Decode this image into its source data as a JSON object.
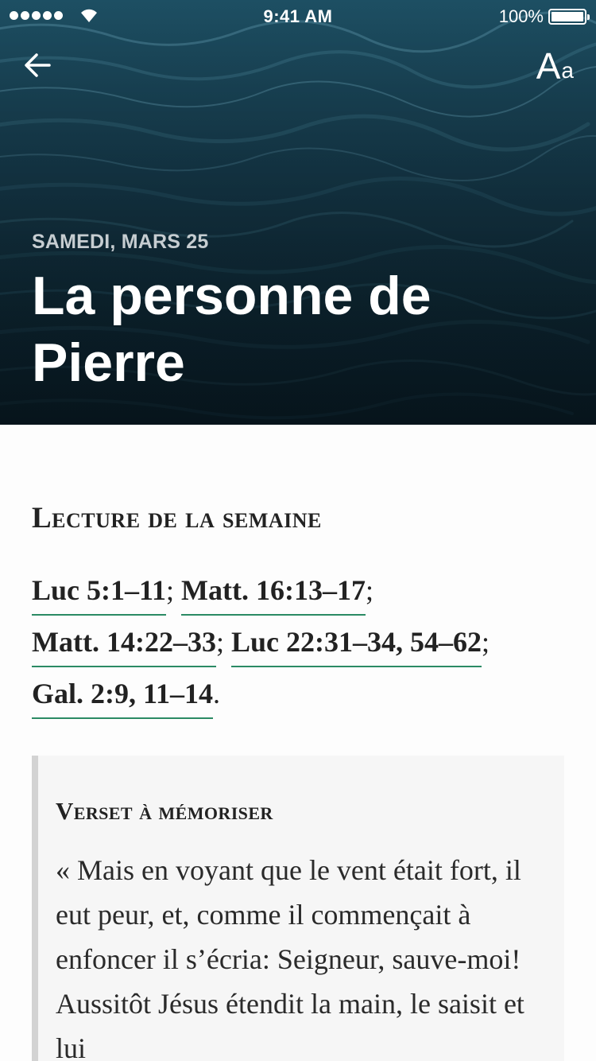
{
  "status_bar": {
    "time": "9:41 AM",
    "battery": "100%"
  },
  "header": {
    "back_icon": "arrow-left-icon",
    "font_settings_big": "A",
    "font_settings_small": "a",
    "date": "SAMEDI, MARS 25",
    "title": "La personne de Pierre"
  },
  "weekly_reading": {
    "heading": "Lecture de la semaine",
    "references": [
      {
        "label": "Luc 5:1–11",
        "sep": "; "
      },
      {
        "label": "Matt. 16:13–17",
        "sep": ";"
      },
      {
        "label": "Matt. 14:22–33",
        "sep": "; "
      },
      {
        "label": "Luc 22:31–34, 54–62",
        "sep": ";"
      },
      {
        "label": "Gal. 2:9, 11–14",
        "sep": "."
      }
    ]
  },
  "memory_verse": {
    "heading": "Verset à mémoriser",
    "text": "« Mais en voyant que le vent était fort, il eut peur, et, comme il commençait à enfoncer il s’écria: Seigneur, sauve-moi! Aussitôt Jésus étendit la main, le saisit et lui"
  },
  "colors": {
    "link_underline": "#2b8a64",
    "hero_water": "#15394a",
    "quote_bar": "#d3d3d3"
  }
}
